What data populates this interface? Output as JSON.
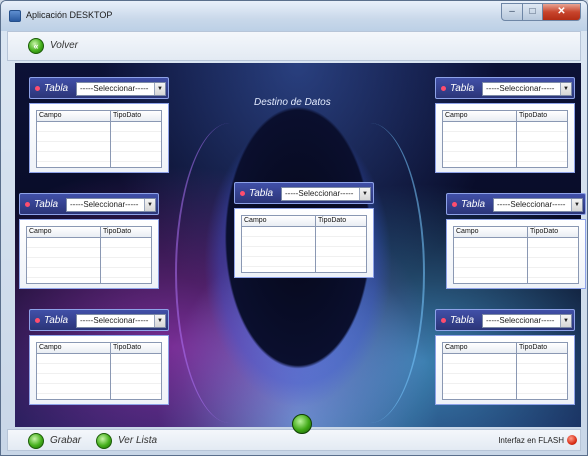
{
  "window": {
    "title": "Aplicación DESKTOP"
  },
  "toolbar": {
    "volver_label": "Volver"
  },
  "destino": {
    "title": "Destino de Datos"
  },
  "panels": [
    {
      "label": "Tabla",
      "selected": "-----Seleccionar-----",
      "col1": "Campo",
      "col2": "TipoDato"
    },
    {
      "label": "Tabla",
      "selected": "-----Seleccionar-----",
      "col1": "Campo",
      "col2": "TipoDato"
    },
    {
      "label": "Tabla",
      "selected": "-----Seleccionar-----",
      "col1": "Campo",
      "col2": "TipoDato"
    },
    {
      "label": "Tabla",
      "selected": "-----Seleccionar-----",
      "col1": "Campo",
      "col2": "TipoDato"
    },
    {
      "label": "Tabla",
      "selected": "-----Seleccionar-----",
      "col1": "Campo",
      "col2": "TipoDato"
    },
    {
      "label": "Tabla",
      "selected": "-----Seleccionar-----",
      "col1": "Campo",
      "col2": "TipoDato"
    },
    {
      "label": "Tabla",
      "selected": "-----Seleccionar-----",
      "col1": "Campo",
      "col2": "TipoDato"
    }
  ],
  "bottom": {
    "grabar_label": "Grabar",
    "ver_lista_label": "Ver Lista",
    "flash_label": "Interfaz en FLASH"
  },
  "icons": {
    "volver": "back-arrow-icon",
    "grabar": "green-orb-icon",
    "ver_lista": "green-orb-icon",
    "flash": "red-orb-icon"
  }
}
